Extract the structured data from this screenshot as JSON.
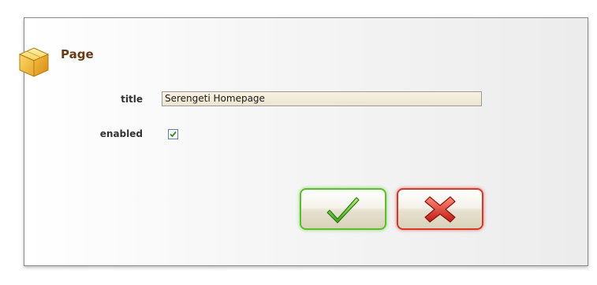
{
  "header": {
    "title": "Page",
    "icon": "box-icon"
  },
  "form": {
    "title_label": "title",
    "title_value": "Serengeti Homepage",
    "enabled_label": "enabled",
    "enabled_checked": true
  },
  "actions": {
    "ok_icon": "checkmark-icon",
    "cancel_icon": "cross-icon"
  },
  "colors": {
    "title_text": "#6b3a12",
    "ok_border": "#5bbf2a",
    "cancel_border": "#d23a2a"
  }
}
